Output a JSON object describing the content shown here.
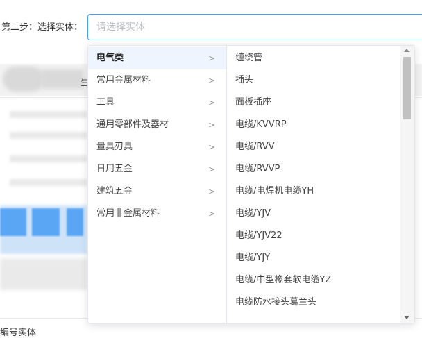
{
  "form": {
    "step_label": "第二步：选择实体：",
    "entity_placeholder": "请选择实体",
    "entity_value": ""
  },
  "cascader": {
    "categories": [
      {
        "label": "电气类",
        "active": true
      },
      {
        "label": "常用金属材料",
        "active": false
      },
      {
        "label": "工具",
        "active": false
      },
      {
        "label": "通用零部件及器材",
        "active": false
      },
      {
        "label": "量具刃具",
        "active": false
      },
      {
        "label": "日用五金",
        "active": false
      },
      {
        "label": "建筑五金",
        "active": false
      },
      {
        "label": "常用非金属材料",
        "active": false
      }
    ],
    "chevron": ">",
    "items": [
      "缠绕管",
      "插头",
      "面板插座",
      "电缆/KVVRP",
      "电缆/RVV",
      "电缆/RVVP",
      "电缆/电焊机电缆YH",
      "电缆/YJV",
      "电缆/YJV22",
      "电缆/YJY",
      "电缆/中型橡套软电缆YZ",
      "电缆防水接头葛兰头"
    ]
  },
  "background": {
    "partial_label": "生",
    "bottom_text": "编号实体"
  }
}
